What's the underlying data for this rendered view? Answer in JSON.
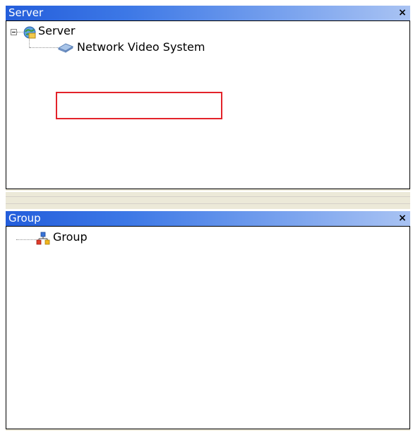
{
  "server_panel": {
    "title": "Server",
    "close_label": "×",
    "tree": {
      "root_label": "Server",
      "child_label": "Network Video System"
    }
  },
  "group_panel": {
    "title": "Group",
    "close_label": "×",
    "tree": {
      "root_label": "Group"
    }
  },
  "colors": {
    "titlebar_start": "#245edb",
    "titlebar_end": "#a9c3f3",
    "highlight_border": "#e3232a",
    "panel_bg": "#ece9d8"
  }
}
